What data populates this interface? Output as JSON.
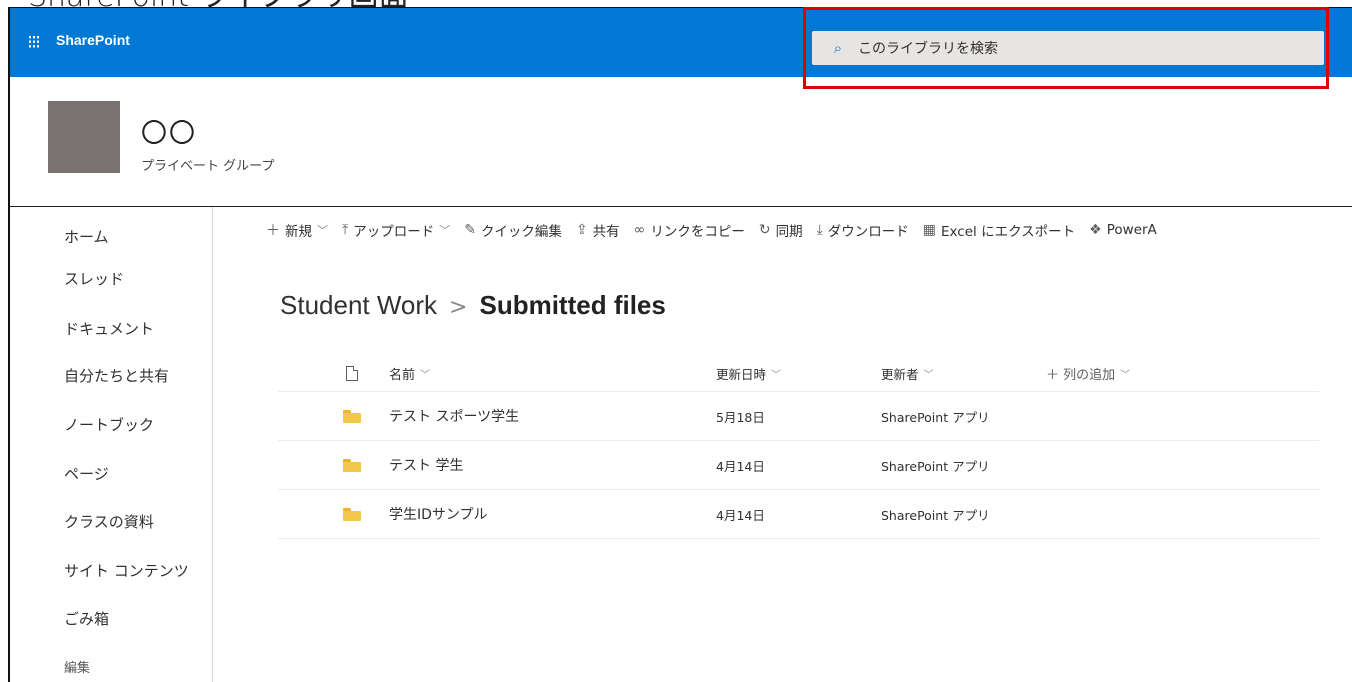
{
  "caption": "SharePoint ライブラリ画面",
  "suitebar": {
    "brand": "SharePoint",
    "waffle_icon": "waffle-icon",
    "search_placeholder": "このライブラリを検索",
    "color": "#0078d4"
  },
  "site": {
    "title": "〇〇",
    "subtitle": "プライベート グループ"
  },
  "nav": {
    "items": [
      {
        "label": "ホーム"
      },
      {
        "label": "スレッド"
      },
      {
        "label": "ドキュメント"
      },
      {
        "label": "自分たちと共有"
      },
      {
        "label": "ノートブック"
      },
      {
        "label": "ページ"
      },
      {
        "label": "クラスの資料"
      },
      {
        "label": "サイト コンテンツ"
      },
      {
        "label": "ごみ箱"
      },
      {
        "label": "編集"
      }
    ]
  },
  "commandbar": {
    "new": "新規",
    "upload": "アップロード",
    "quick_edit": "クイック編集",
    "share": "共有",
    "copy_link": "リンクをコピー",
    "sync": "同期",
    "download": "ダウンロード",
    "export_excel": "Excel にエクスポート",
    "power_apps": "PowerA"
  },
  "breadcrumb": {
    "parent": "Student Work",
    "separator": ">",
    "current": "Submitted files"
  },
  "list": {
    "columns": {
      "name": "名前",
      "modified": "更新日時",
      "modified_by": "更新者",
      "add_column": "列の追加"
    },
    "rows": [
      {
        "name": "テスト スポーツ学生",
        "modified": "5月18日",
        "modified_by": "SharePoint アプリ"
      },
      {
        "name": "テスト 学生",
        "modified": "4月14日",
        "modified_by": "SharePoint アプリ"
      },
      {
        "name": "学生IDサンプル",
        "modified": "4月14日",
        "modified_by": "SharePoint アプリ"
      }
    ]
  },
  "colors": {
    "accent": "#0078d4",
    "highlight_box": "#e00000",
    "folder": "#f3c74b"
  }
}
